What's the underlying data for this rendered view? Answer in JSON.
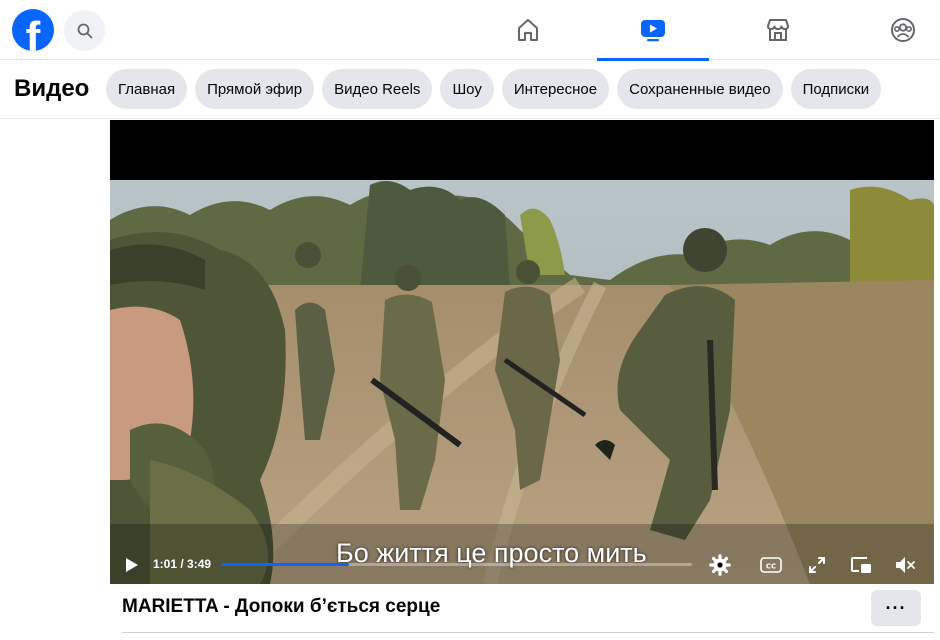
{
  "topbar": {
    "logo_letter": "f",
    "nav": [
      {
        "name": "home-icon",
        "active": false
      },
      {
        "name": "video-icon",
        "active": true
      },
      {
        "name": "marketplace-icon",
        "active": false
      },
      {
        "name": "groups-icon",
        "active": false
      }
    ],
    "accent": "#0866ff"
  },
  "subbar": {
    "title": "Видео",
    "chips": [
      "Главная",
      "Прямой эфир",
      "Видео Reels",
      "Шоу",
      "Интересное",
      "Сохраненные видео",
      "Подписки"
    ]
  },
  "player": {
    "subtitle": "Бо життя це просто мить",
    "time": "1:01 / 3:49",
    "progress": 0.27,
    "controls": [
      "play-icon",
      "settings-icon",
      "captions-icon",
      "fullscreen-icon",
      "picture-in-picture-icon",
      "volume-muted-icon"
    ]
  },
  "video": {
    "title": "MARIETTA - Допоки б’ється серце",
    "more_label": "···"
  }
}
